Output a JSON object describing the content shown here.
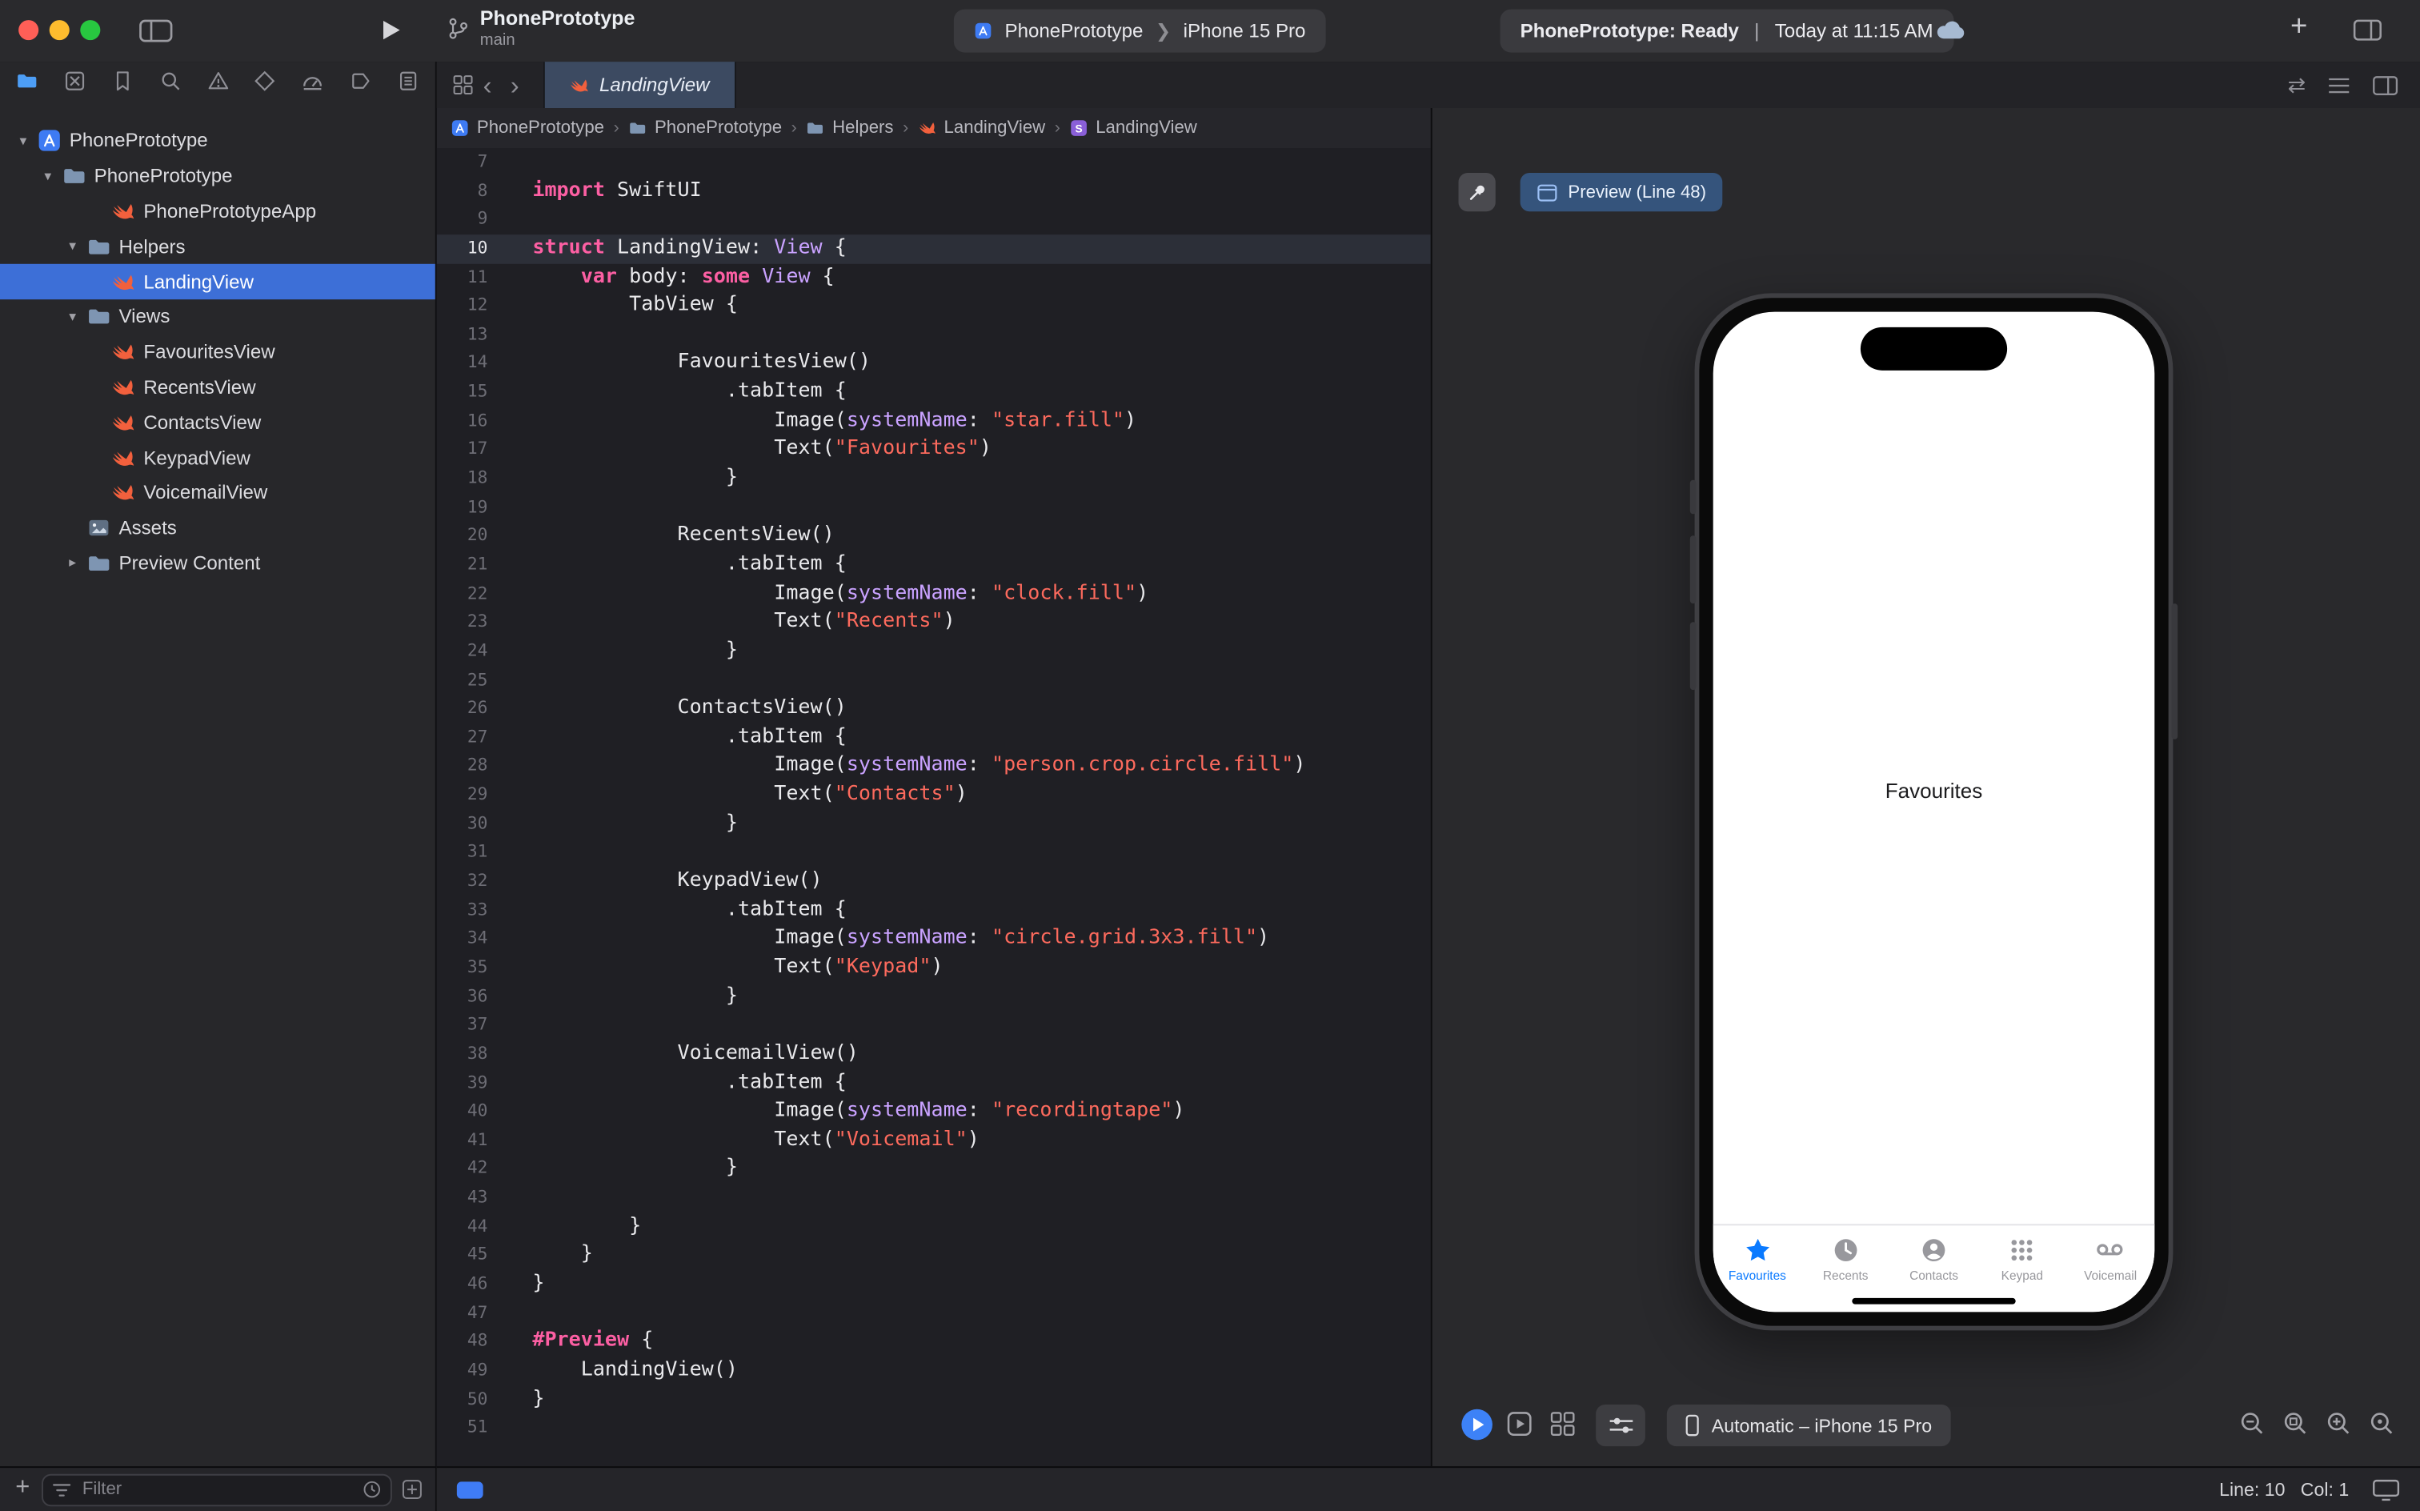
{
  "window": {
    "toolbar": {
      "project_name": "PhonePrototype",
      "branch_name": "main",
      "scheme_name": "PhonePrototype",
      "run_destination": "iPhone 15 Pro",
      "status_left": "PhonePrototype: Ready",
      "status_right": "Today at 11:15 AM"
    },
    "traffic_lights": [
      "close",
      "minimize",
      "zoom"
    ]
  },
  "navigator": {
    "tabs": [
      "project",
      "source-control",
      "bookmarks",
      "find",
      "issues",
      "tests",
      "debug",
      "breakpoints",
      "reports"
    ],
    "tree": [
      {
        "label": "PhonePrototype",
        "icon": "project",
        "level": 0,
        "disclosure": "open",
        "selected": false
      },
      {
        "label": "PhonePrototype",
        "icon": "folder",
        "level": 1,
        "disclosure": "open",
        "selected": false
      },
      {
        "label": "PhonePrototypeApp",
        "icon": "swift",
        "level": 3,
        "disclosure": null,
        "selected": false
      },
      {
        "label": "Helpers",
        "icon": "folder",
        "level": 2,
        "disclosure": "open",
        "selected": false
      },
      {
        "label": "LandingView",
        "icon": "swift",
        "level": 3,
        "disclosure": null,
        "selected": true
      },
      {
        "label": "Views",
        "icon": "folder",
        "level": 2,
        "disclosure": "open",
        "selected": false
      },
      {
        "label": "FavouritesView",
        "icon": "swift",
        "level": 3,
        "disclosure": null,
        "selected": false
      },
      {
        "label": "RecentsView",
        "icon": "swift",
        "level": 3,
        "disclosure": null,
        "selected": false
      },
      {
        "label": "ContactsView",
        "icon": "swift",
        "level": 3,
        "disclosure": null,
        "selected": false
      },
      {
        "label": "KeypadView",
        "icon": "swift",
        "level": 3,
        "disclosure": null,
        "selected": false
      },
      {
        "label": "VoicemailView",
        "icon": "swift",
        "level": 3,
        "disclosure": null,
        "selected": false
      },
      {
        "label": "Assets",
        "icon": "assets",
        "level": 2,
        "disclosure": null,
        "selected": false
      },
      {
        "label": "Preview Content",
        "icon": "folder",
        "level": 2,
        "disclosure": "closed",
        "selected": false
      }
    ],
    "filter_placeholder": "Filter"
  },
  "editor": {
    "tab": "LandingView",
    "breadcrumbs": [
      {
        "icon": "project",
        "label": "PhonePrototype"
      },
      {
        "icon": "folder",
        "label": "PhonePrototype"
      },
      {
        "icon": "folder",
        "label": "Helpers"
      },
      {
        "icon": "swift",
        "label": "LandingView"
      },
      {
        "icon": "struct",
        "label": "LandingView"
      }
    ],
    "current_line": 10,
    "lines": [
      {
        "n": 7,
        "t": []
      },
      {
        "n": 8,
        "t": [
          [
            "k",
            "import"
          ],
          [
            "p",
            " SwiftUI"
          ]
        ]
      },
      {
        "n": 9,
        "t": []
      },
      {
        "n": 10,
        "t": [
          [
            "k",
            "struct"
          ],
          [
            "p",
            " LandingView: "
          ],
          [
            "t",
            "View"
          ],
          [
            "p",
            " {"
          ]
        ]
      },
      {
        "n": 11,
        "t": [
          [
            "p",
            "    "
          ],
          [
            "k",
            "var"
          ],
          [
            "p",
            " body: "
          ],
          [
            "k",
            "some"
          ],
          [
            "p",
            " "
          ],
          [
            "t",
            "View"
          ],
          [
            "p",
            " {"
          ]
        ]
      },
      {
        "n": 12,
        "t": [
          [
            "p",
            "        TabView {"
          ]
        ]
      },
      {
        "n": 13,
        "t": []
      },
      {
        "n": 14,
        "t": [
          [
            "p",
            "            FavouritesView()"
          ]
        ]
      },
      {
        "n": 15,
        "t": [
          [
            "p",
            "                .tabItem {"
          ]
        ]
      },
      {
        "n": 16,
        "t": [
          [
            "p",
            "                    Image("
          ],
          [
            "t",
            "systemName"
          ],
          [
            "p",
            ": "
          ],
          [
            "s",
            "\"star.fill\""
          ],
          [
            "p",
            ")"
          ]
        ]
      },
      {
        "n": 17,
        "t": [
          [
            "p",
            "                    Text("
          ],
          [
            "s",
            "\"Favourites\""
          ],
          [
            "p",
            ")"
          ]
        ]
      },
      {
        "n": 18,
        "t": [
          [
            "p",
            "                }"
          ]
        ]
      },
      {
        "n": 19,
        "t": []
      },
      {
        "n": 20,
        "t": [
          [
            "p",
            "            RecentsView()"
          ]
        ]
      },
      {
        "n": 21,
        "t": [
          [
            "p",
            "                .tabItem {"
          ]
        ]
      },
      {
        "n": 22,
        "t": [
          [
            "p",
            "                    Image("
          ],
          [
            "t",
            "systemName"
          ],
          [
            "p",
            ": "
          ],
          [
            "s",
            "\"clock.fill\""
          ],
          [
            "p",
            ")"
          ]
        ]
      },
      {
        "n": 23,
        "t": [
          [
            "p",
            "                    Text("
          ],
          [
            "s",
            "\"Recents\""
          ],
          [
            "p",
            ")"
          ]
        ]
      },
      {
        "n": 24,
        "t": [
          [
            "p",
            "                }"
          ]
        ]
      },
      {
        "n": 25,
        "t": []
      },
      {
        "n": 26,
        "t": [
          [
            "p",
            "            ContactsView()"
          ]
        ]
      },
      {
        "n": 27,
        "t": [
          [
            "p",
            "                .tabItem {"
          ]
        ]
      },
      {
        "n": 28,
        "t": [
          [
            "p",
            "                    Image("
          ],
          [
            "t",
            "systemName"
          ],
          [
            "p",
            ": "
          ],
          [
            "s",
            "\"person.crop.circle.fill\""
          ],
          [
            "p",
            ")"
          ]
        ]
      },
      {
        "n": 29,
        "t": [
          [
            "p",
            "                    Text("
          ],
          [
            "s",
            "\"Contacts\""
          ],
          [
            "p",
            ")"
          ]
        ]
      },
      {
        "n": 30,
        "t": [
          [
            "p",
            "                }"
          ]
        ]
      },
      {
        "n": 31,
        "t": []
      },
      {
        "n": 32,
        "t": [
          [
            "p",
            "            KeypadView()"
          ]
        ]
      },
      {
        "n": 33,
        "t": [
          [
            "p",
            "                .tabItem {"
          ]
        ]
      },
      {
        "n": 34,
        "t": [
          [
            "p",
            "                    Image("
          ],
          [
            "t",
            "systemName"
          ],
          [
            "p",
            ": "
          ],
          [
            "s",
            "\"circle.grid.3x3.fill\""
          ],
          [
            "p",
            ")"
          ]
        ]
      },
      {
        "n": 35,
        "t": [
          [
            "p",
            "                    Text("
          ],
          [
            "s",
            "\"Keypad\""
          ],
          [
            "p",
            ")"
          ]
        ]
      },
      {
        "n": 36,
        "t": [
          [
            "p",
            "                }"
          ]
        ]
      },
      {
        "n": 37,
        "t": []
      },
      {
        "n": 38,
        "t": [
          [
            "p",
            "            VoicemailView()"
          ]
        ]
      },
      {
        "n": 39,
        "t": [
          [
            "p",
            "                .tabItem {"
          ]
        ]
      },
      {
        "n": 40,
        "t": [
          [
            "p",
            "                    Image("
          ],
          [
            "t",
            "systemName"
          ],
          [
            "p",
            ": "
          ],
          [
            "s",
            "\"recordingtape\""
          ],
          [
            "p",
            ")"
          ]
        ]
      },
      {
        "n": 41,
        "t": [
          [
            "p",
            "                    Text("
          ],
          [
            "s",
            "\"Voicemail\""
          ],
          [
            "p",
            ")"
          ]
        ]
      },
      {
        "n": 42,
        "t": [
          [
            "p",
            "                }"
          ]
        ]
      },
      {
        "n": 43,
        "t": []
      },
      {
        "n": 44,
        "t": [
          [
            "p",
            "        }"
          ]
        ]
      },
      {
        "n": 45,
        "t": [
          [
            "p",
            "    }"
          ]
        ]
      },
      {
        "n": 46,
        "t": [
          [
            "p",
            "}"
          ]
        ]
      },
      {
        "n": 47,
        "t": []
      },
      {
        "n": 48,
        "t": [
          [
            "k",
            "#Preview"
          ],
          [
            "p",
            " {"
          ]
        ]
      },
      {
        "n": 49,
        "t": [
          [
            "p",
            "    LandingView()"
          ]
        ]
      },
      {
        "n": 50,
        "t": [
          [
            "p",
            "}"
          ]
        ]
      },
      {
        "n": 51,
        "t": []
      }
    ]
  },
  "preview": {
    "tab_label": "Preview (Line 48)",
    "device_button": "Automatic – iPhone 15 Pro",
    "zoom_icons": [
      "zoom-out",
      "zoom-to-fit",
      "zoom-in",
      "zoom-selection"
    ],
    "phone": {
      "content_title": "Favourites",
      "tab_bar": [
        {
          "icon": "star",
          "label": "Favourites",
          "active": true
        },
        {
          "icon": "clock",
          "label": "Recents",
          "active": false
        },
        {
          "icon": "person",
          "label": "Contacts",
          "active": false
        },
        {
          "icon": "keypad",
          "label": "Keypad",
          "active": false
        },
        {
          "icon": "voicemail",
          "label": "Voicemail",
          "active": false
        }
      ]
    }
  },
  "statusbar": {
    "line": "Line: 10",
    "col": "Col: 1"
  },
  "colors": {
    "selection_blue": "#3d6fd7",
    "ios_blue": "#0a7aff",
    "swift_orange": "#f2603d",
    "keyword_pink": "#fc5fa3",
    "string_red": "#fc6a5d",
    "type_lavender": "#c9a2ff"
  }
}
